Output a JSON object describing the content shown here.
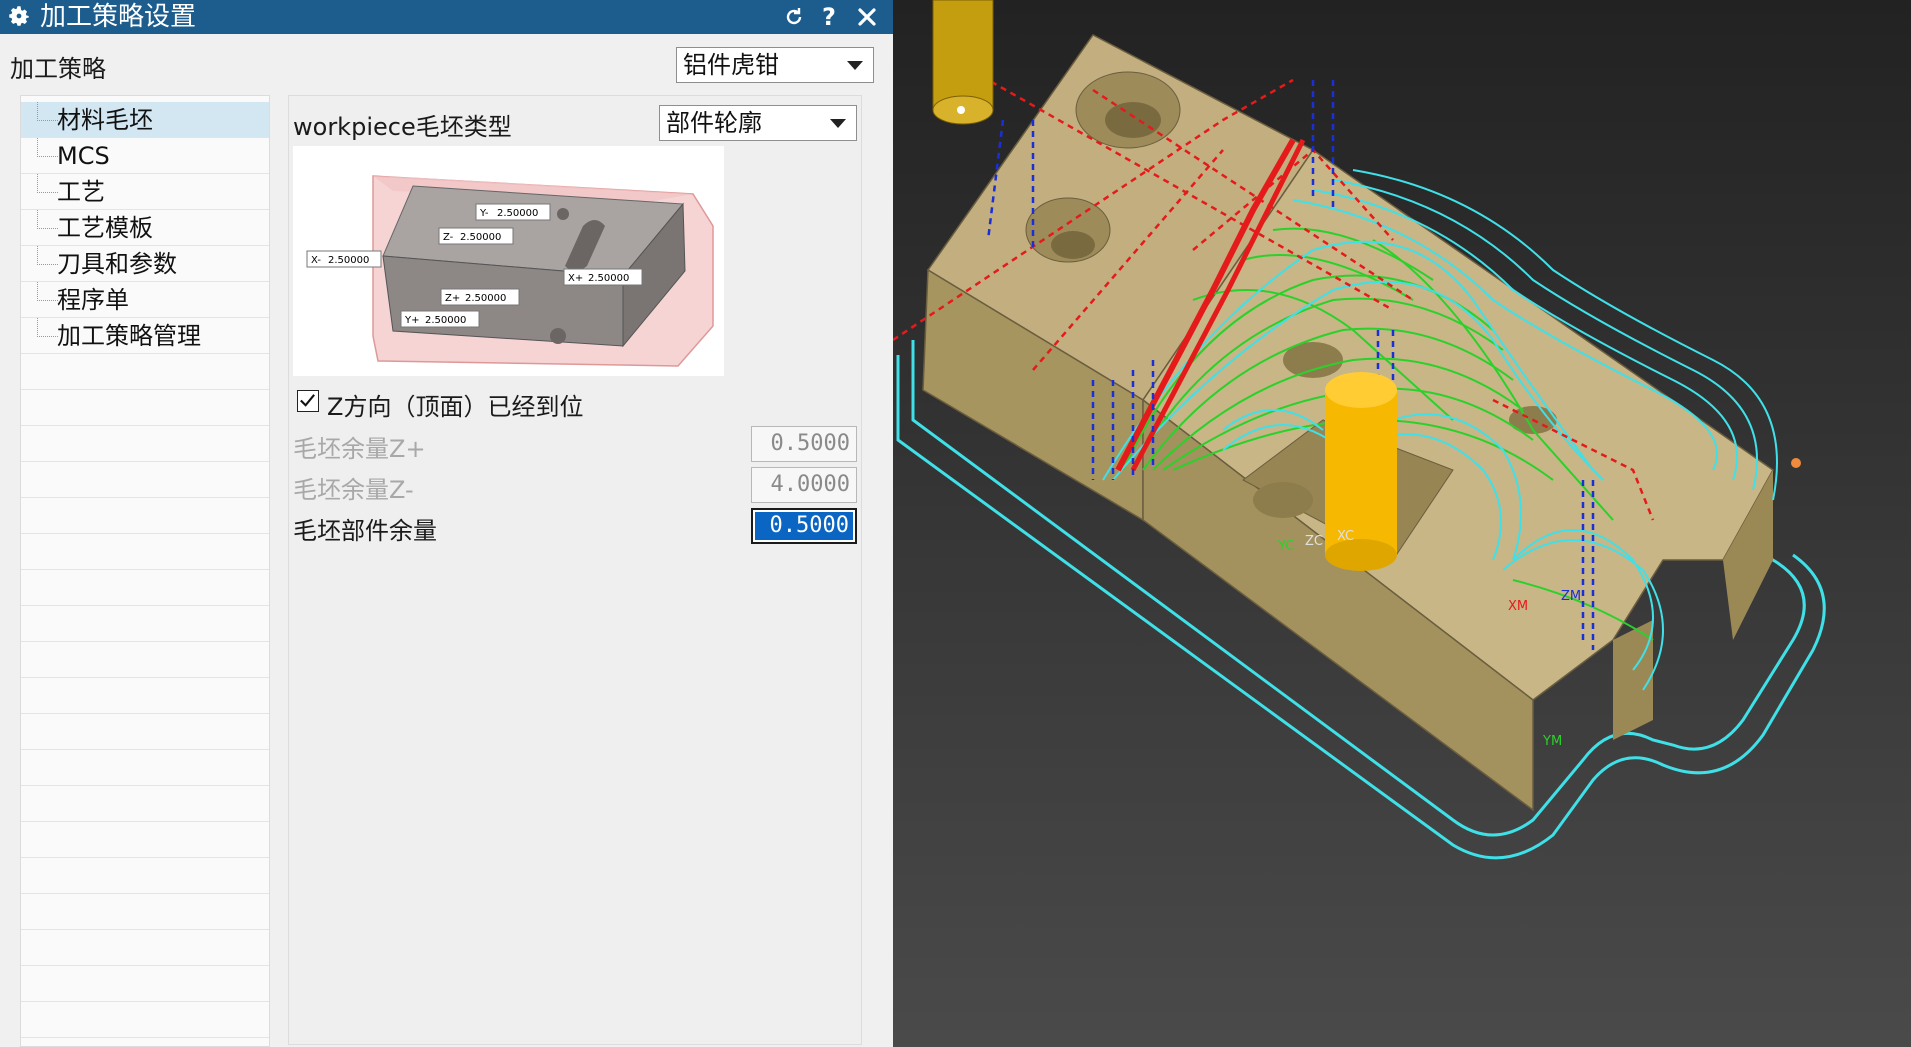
{
  "dialog": {
    "title": "加工策略设置",
    "strategy_label": "加工策略",
    "strategy_value": "铝件虎钳",
    "tree_items": [
      "材料毛坯",
      "MCS",
      "工艺",
      "工艺模板",
      "刀具和参数",
      "程序单",
      "加工策略管理"
    ],
    "workpiece_label": "workpiece毛坯类型",
    "workpiece_value": "部件轮廓",
    "preview": {
      "y_minus_label": "Y-",
      "y_minus_value": "2.50000",
      "z_minus_label": "Z-",
      "z_minus_value": "2.50000",
      "x_minus_label": "X-",
      "x_minus_value": "2.50000",
      "x_plus_label": "X+",
      "x_plus_value": "2.50000",
      "z_plus_label": "Z+",
      "z_plus_value": "2.50000",
      "y_plus_label": "Y+",
      "y_plus_value": "2.50000"
    },
    "z_reached_label": "Z方向（顶面）已经到位",
    "z_reached_checked": true,
    "blank_z_plus_label": "毛坯余量Z+",
    "blank_z_plus_value": "0.5000",
    "blank_z_minus_label": "毛坯余量Z-",
    "blank_z_minus_value": "4.0000",
    "blank_part_label": "毛坯部件余量",
    "blank_part_value": "0.5000"
  },
  "viewport": {
    "axis_labels": [
      "YC",
      "ZC",
      "XC",
      "XM",
      "ZM",
      "YM"
    ]
  },
  "colors": {
    "titlebar": "#1c5d8e",
    "selected_tree": "#d3e7f3",
    "toolpath_cyan": "#3fe0e8",
    "toolpath_green": "#2bd12b",
    "toolpath_red": "#e51b1b",
    "toolpath_blue": "#1a2fd6",
    "part_tan": "#b9a77a",
    "tool_yellow": "#f6b800"
  }
}
